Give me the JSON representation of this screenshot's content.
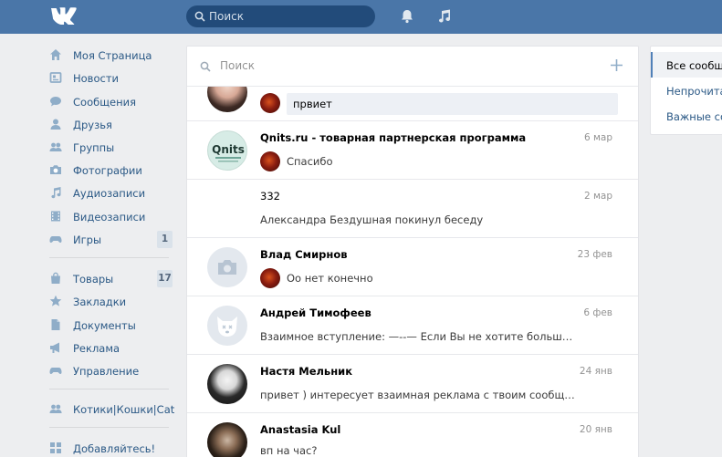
{
  "header": {
    "logo": "VK",
    "search_placeholder": "Поиск",
    "icons": [
      "bell-icon",
      "music-icon"
    ]
  },
  "nav": {
    "items": [
      {
        "label": "Моя Страница",
        "icon": "home-icon"
      },
      {
        "label": "Новости",
        "icon": "news-icon"
      },
      {
        "label": "Сообщения",
        "icon": "messages-icon"
      },
      {
        "label": "Друзья",
        "icon": "friend-icon"
      },
      {
        "label": "Группы",
        "icon": "groups-icon"
      },
      {
        "label": "Фотографии",
        "icon": "camera-icon"
      },
      {
        "label": "Аудиозаписи",
        "icon": "music-note-icon"
      },
      {
        "label": "Видеозаписи",
        "icon": "film-icon"
      },
      {
        "label": "Игры",
        "icon": "gamepad-icon",
        "badge": "1"
      },
      {
        "label": "Товары",
        "icon": "bag-icon",
        "badge": "17"
      },
      {
        "label": "Закладки",
        "icon": "star-icon"
      },
      {
        "label": "Документы",
        "icon": "document-icon"
      },
      {
        "label": "Реклама",
        "icon": "megaphone-icon"
      },
      {
        "label": "Управление",
        "icon": "gamepad-manage-icon"
      },
      {
        "label": "Котики|Кошки|Cat",
        "icon": "group-icon"
      },
      {
        "label": "Добавляйтесь!",
        "icon": "grid-icon"
      }
    ]
  },
  "dialogs": {
    "search_placeholder": "Поиск",
    "items": [
      {
        "name": "",
        "date": "",
        "message": "првиет",
        "unread": true
      },
      {
        "name": "Qnits.ru - товарная партнерская программа",
        "date": "6 мар",
        "message": "Спасибо",
        "avatar_text": "Qnits"
      },
      {
        "name": "332",
        "date": "2 мар",
        "message": "Александра Бездушная покинул беседу"
      },
      {
        "name": "Влад Смирнов",
        "date": "23 фев",
        "message": "Оо нет конечно"
      },
      {
        "name": "Андрей Тимофеев",
        "date": "6 фев",
        "message": "Взаимное вступление: —--— Если Вы не хотите больше участ..."
      },
      {
        "name": "Настя Мельник",
        "date": "24 янв",
        "message": "привет ) интересует взаимная реклама с твоим сообщество..."
      },
      {
        "name": "Anastasia Kul",
        "date": "20 янв",
        "message": "вп на час?"
      }
    ]
  },
  "filters": {
    "items": [
      {
        "label": "Все сообщения",
        "active": true
      },
      {
        "label": "Непрочитанные"
      },
      {
        "label": "Важные сообщения"
      }
    ]
  },
  "colors": {
    "header": "#4a76a8",
    "link": "#2a5885",
    "background": "#edeef0"
  }
}
